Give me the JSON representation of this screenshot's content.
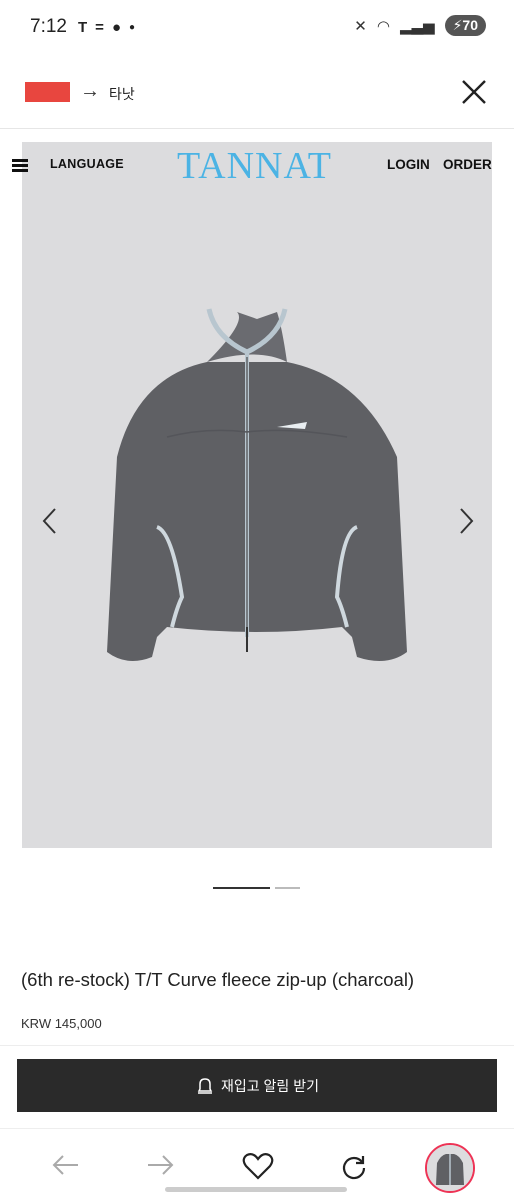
{
  "status_bar": {
    "time": "7:12",
    "left_icons": [
      "tesla-icon",
      "equals-icon",
      "chat-bubble-icon",
      "dot-icon"
    ],
    "battery": "70"
  },
  "top_bar": {
    "translate_label": "타낫"
  },
  "site_header": {
    "language": "LANGUAGE",
    "brand": "TANNAT",
    "login": "LOGIN",
    "order": "ORDER"
  },
  "product": {
    "title": "(6th re-stock) T/T Curve fleece zip-up (charcoal)",
    "price": "KRW 145,000",
    "image_index": 1,
    "image_count": 2
  },
  "cta": {
    "notify_label": "재입고 알림 받기"
  },
  "colors": {
    "brand": "#4bb3e4",
    "cta_bg": "#2a2a2a",
    "flag": "#e8463f"
  },
  "bottom_nav": {
    "items": [
      "back-icon",
      "forward-icon",
      "heart-icon",
      "reload-icon",
      "tab-thumbnail"
    ]
  }
}
